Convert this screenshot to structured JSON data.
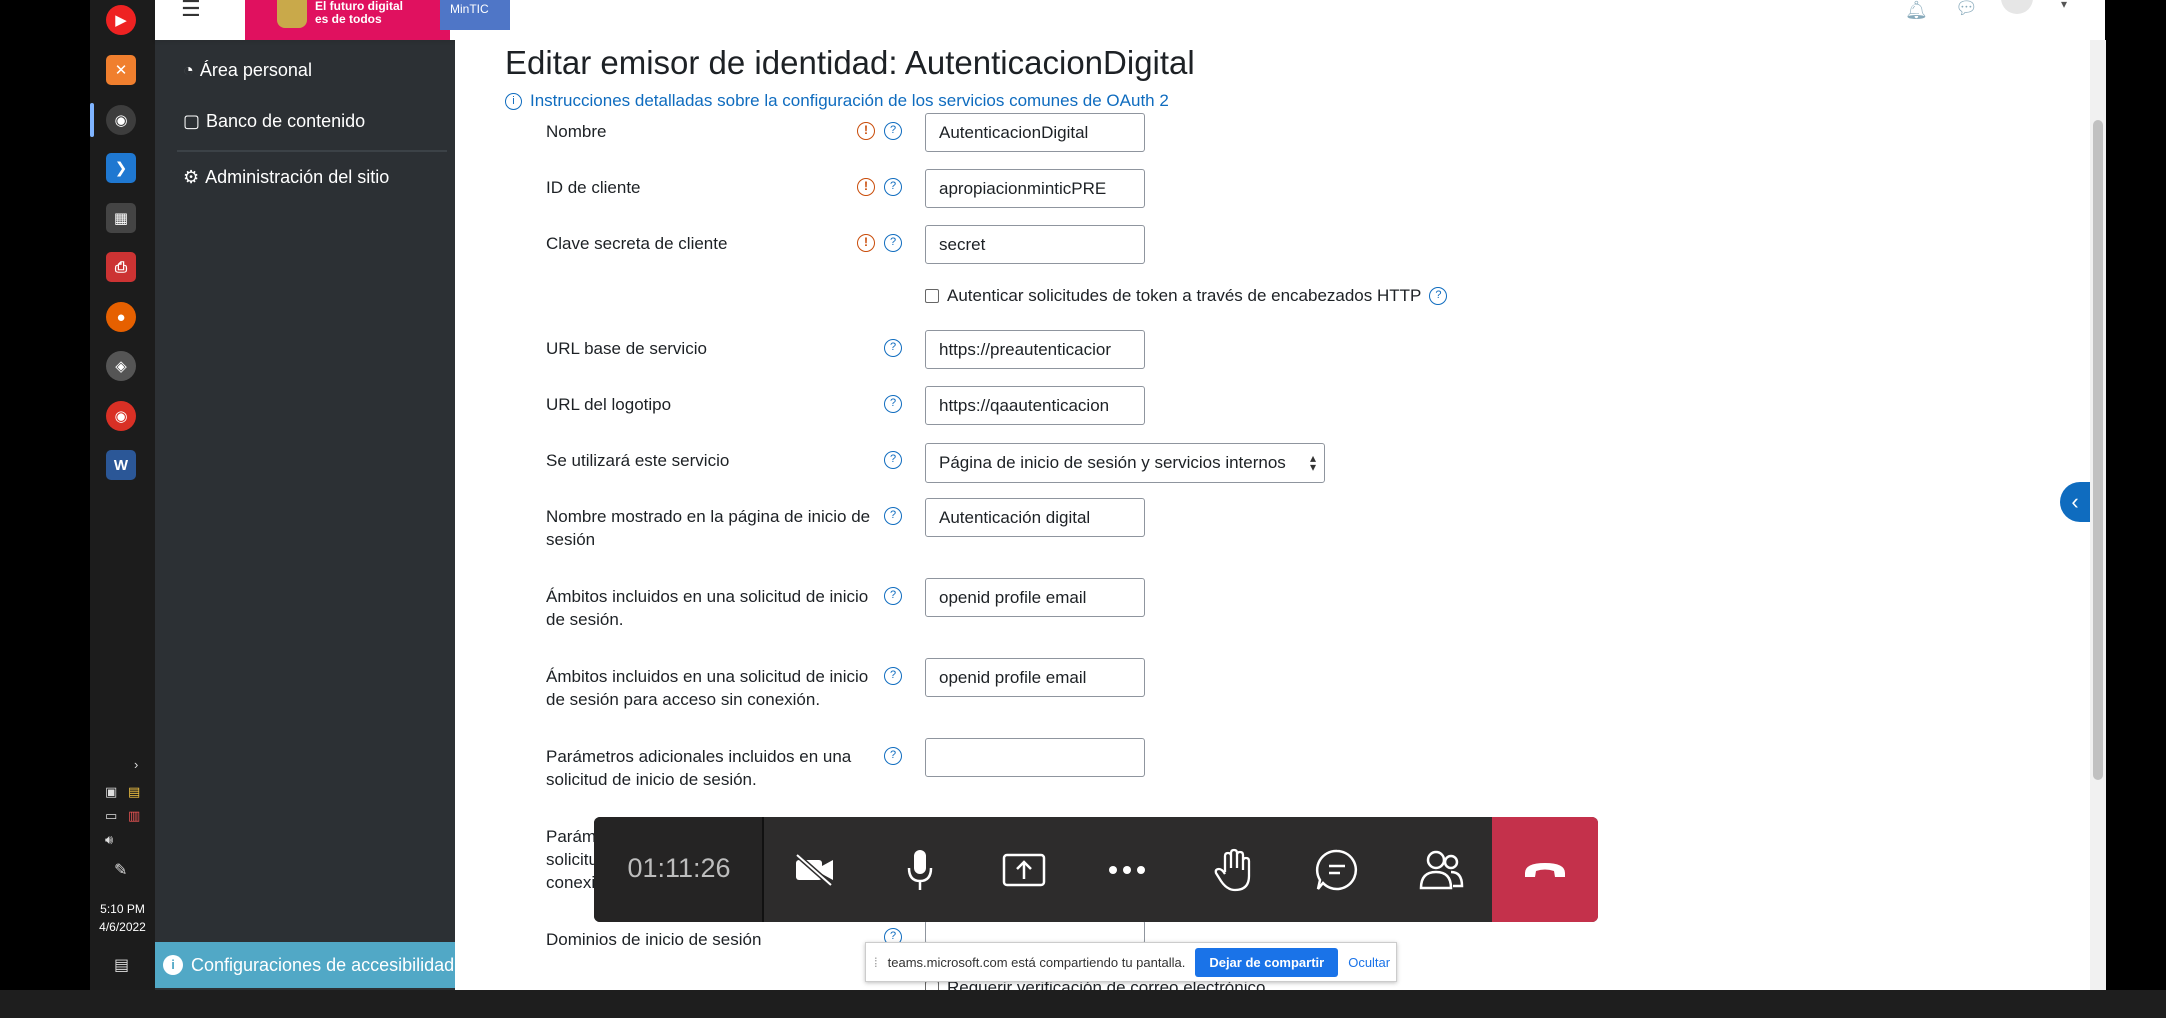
{
  "header": {
    "brand_line1": "El futuro digital",
    "brand_line2": "es de todos",
    "mintic": "MinTIC"
  },
  "sidebar": {
    "items": [
      {
        "label": "Área personal"
      },
      {
        "label": "Banco de contenido"
      },
      {
        "label": "Administración del sitio"
      }
    ],
    "accessibility": "Configuraciones de accesibilidad"
  },
  "taskbar": {
    "time": "5:10 PM",
    "date": "4/6/2022"
  },
  "main": {
    "title": "Editar emisor de identidad: AutenticacionDigital",
    "instructions": "Instrucciones detalladas sobre la configuración de los servicios comunes de OAuth 2",
    "fields": [
      {
        "label": "Nombre",
        "value": "AutenticacionDigital"
      },
      {
        "label": "ID de cliente",
        "value": "apropiacionminticPRE"
      },
      {
        "label": "Clave secreta de cliente",
        "value": "secret"
      },
      {
        "label": "URL base de servicio",
        "value": "https://preautenticacior"
      },
      {
        "label": "URL del logotipo",
        "value": "https://qaautenticacion"
      },
      {
        "label": "Se utilizará este servicio",
        "value": "Página de inicio de sesión y servicios internos"
      },
      {
        "label": "Nombre mostrado en la página de inicio de sesión",
        "value": "Autenticación digital"
      },
      {
        "label": "Ámbitos incluidos en una solicitud de inicio de sesión.",
        "value": "openid profile email"
      },
      {
        "label": "Ámbitos incluidos en una solicitud de inicio de sesión para acceso sin conexión.",
        "value": "openid profile email"
      },
      {
        "label": "Parámetros adicionales incluidos en una solicitud de inicio de sesión.",
        "value": ""
      },
      {
        "label": "Parámetros adicionales incluidos en una solicitud de inicio de sesión para acceso sin conexión.",
        "value": ""
      },
      {
        "label": "Dominios de inicio de sesión",
        "value": ""
      }
    ],
    "http_checkbox": "Autenticar solicitudes de token a través de encabezados HTTP",
    "verify_checkbox": "Requerir verificación de correo electrónico"
  },
  "call": {
    "timer": "01:11:26"
  },
  "share": {
    "message": "teams.microsoft.com está compartiendo tu pantalla.",
    "stop": "Dejar de compartir",
    "hide": "Ocultar"
  }
}
